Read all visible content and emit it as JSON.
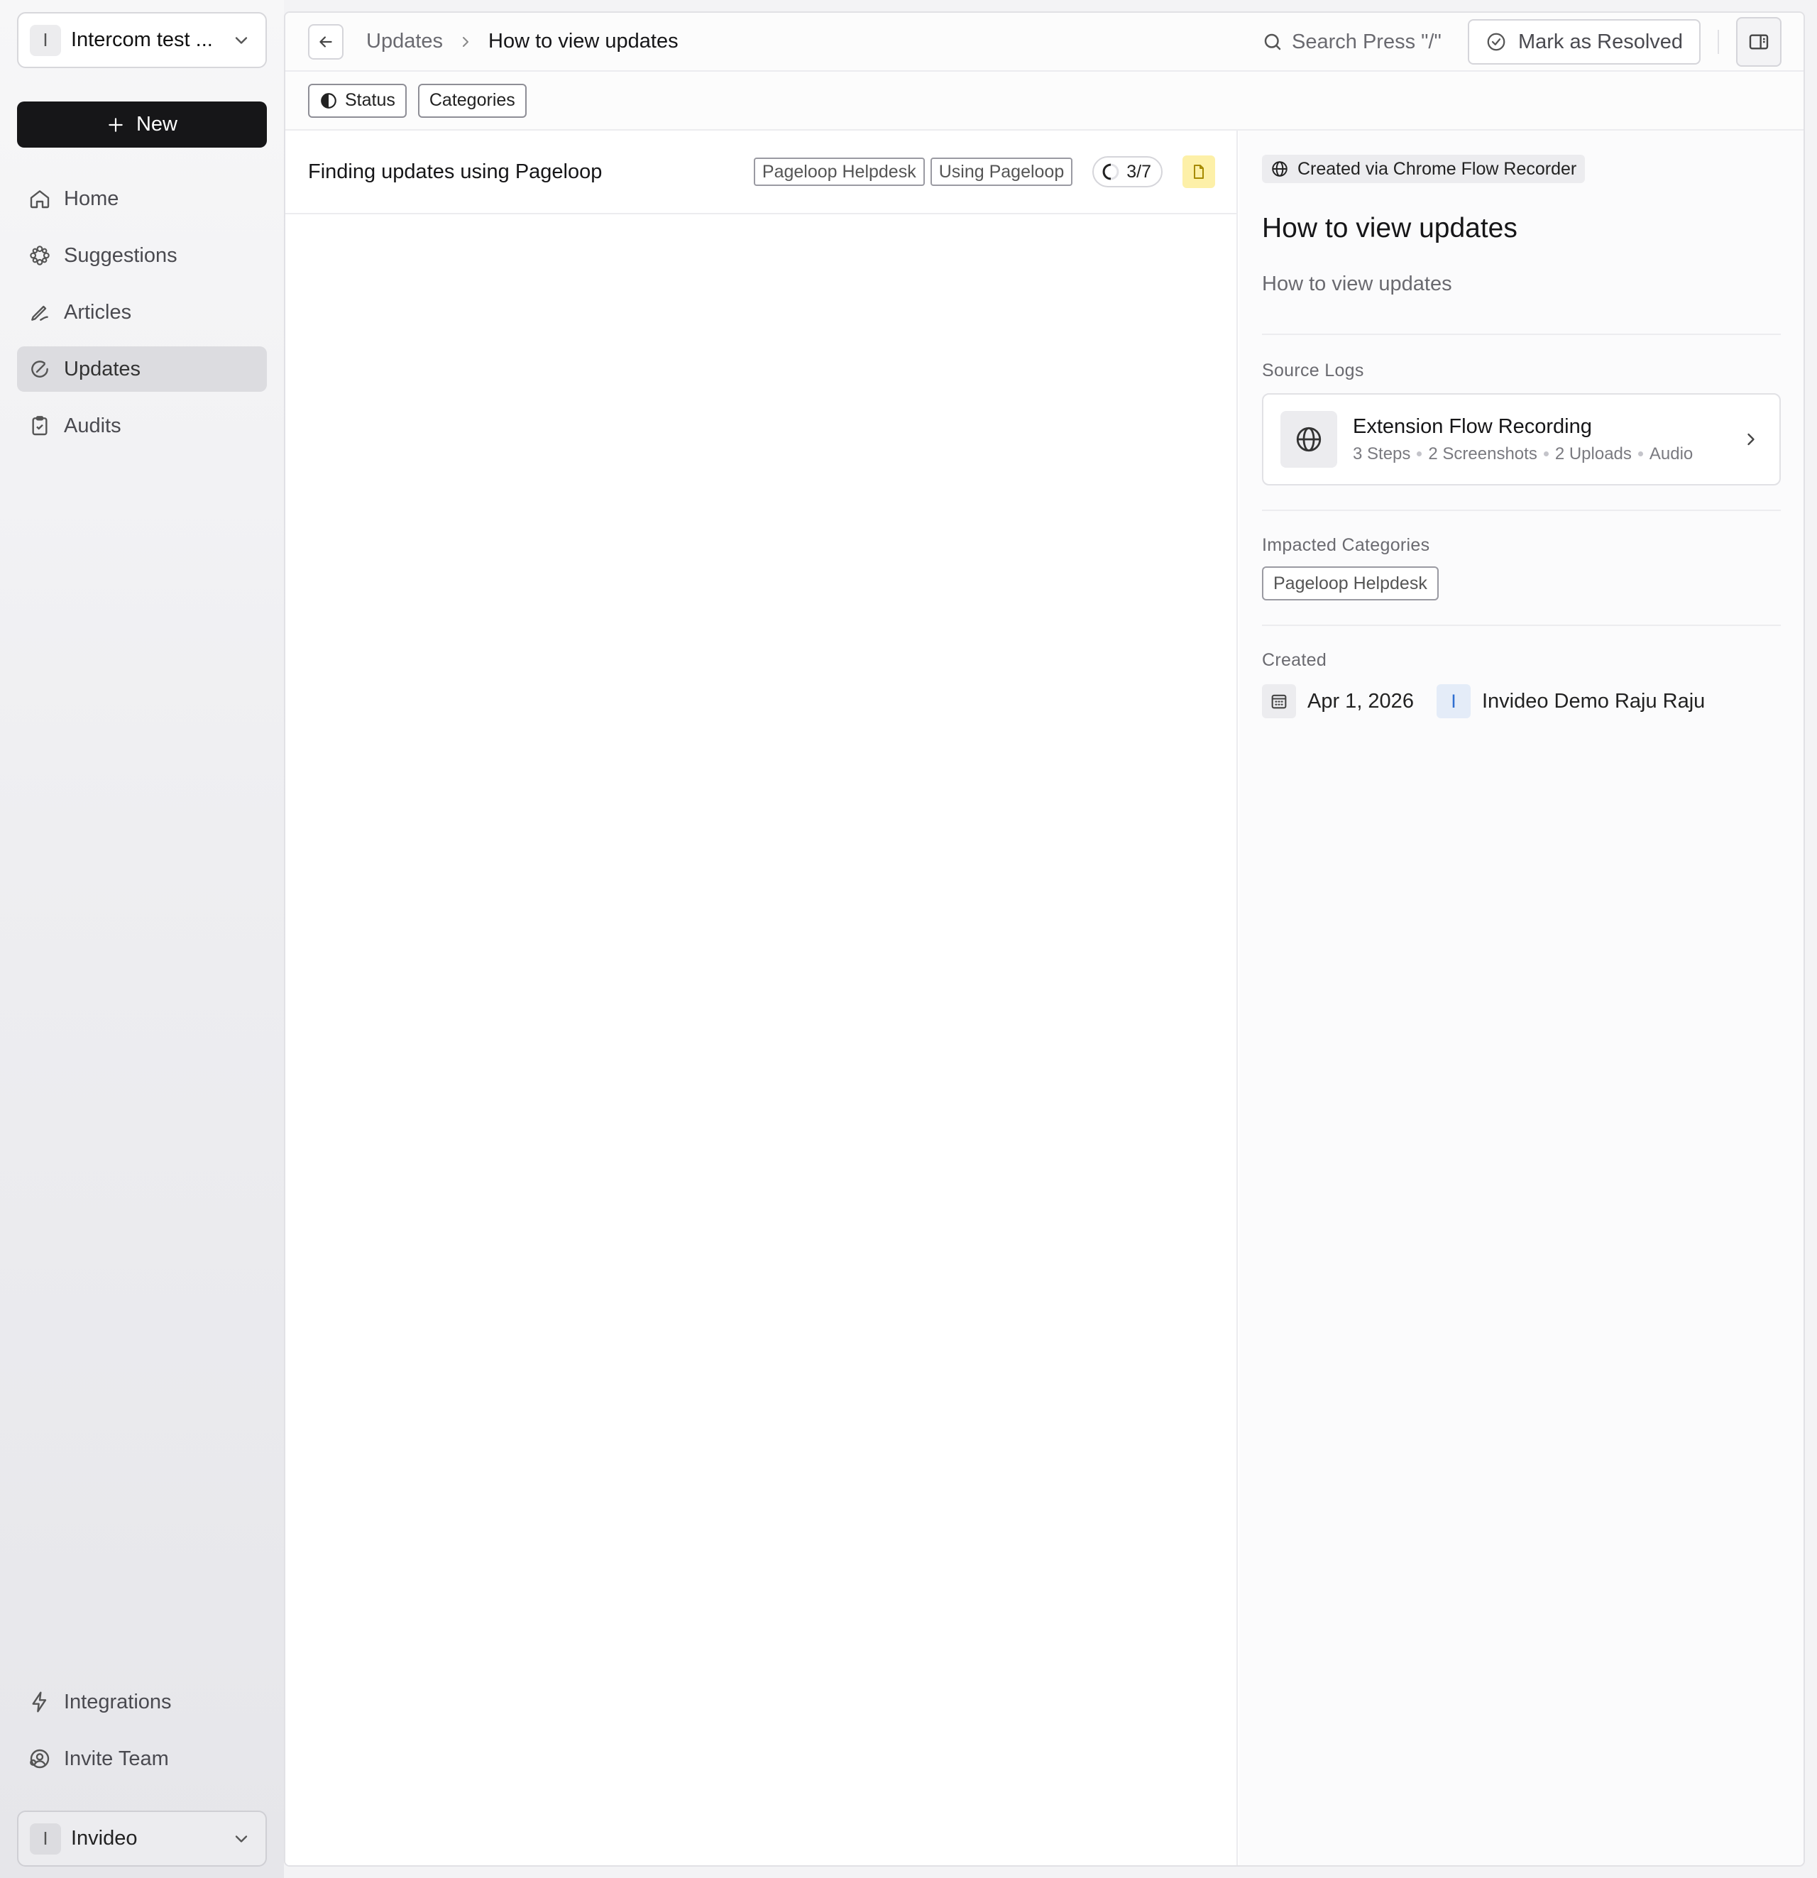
{
  "workspace": {
    "avatar_letter": "I",
    "name": "Intercom test ..."
  },
  "new_button": {
    "label": "New"
  },
  "nav": {
    "items": [
      {
        "label": "Home",
        "icon": "home-icon"
      },
      {
        "label": "Suggestions",
        "icon": "sparkle-icon"
      },
      {
        "label": "Articles",
        "icon": "pen-icon"
      },
      {
        "label": "Updates",
        "icon": "updates-icon",
        "active": true
      },
      {
        "label": "Audits",
        "icon": "clipboard-icon"
      }
    ],
    "bottom_items": [
      {
        "label": "Integrations",
        "icon": "bolt-icon"
      },
      {
        "label": "Invite Team",
        "icon": "team-icon"
      }
    ]
  },
  "user": {
    "avatar_letter": "I",
    "name": "Invideo"
  },
  "topbar": {
    "breadcrumb_parent": "Updates",
    "breadcrumb_current": "How to view updates",
    "search_label": "Search Press \"/\"",
    "resolve_label": "Mark as Resolved"
  },
  "filters": {
    "status_label": "Status",
    "categories_label": "Categories"
  },
  "list": {
    "rows": [
      {
        "title": "Finding updates using Pageloop",
        "tags": [
          "Pageloop Helpdesk",
          "Using Pageloop"
        ],
        "progress": "3/7"
      }
    ]
  },
  "detail": {
    "source_badge": "Created via Chrome Flow Recorder",
    "title": "How to view updates",
    "subtitle": "How to view updates",
    "source_logs_label": "Source Logs",
    "log": {
      "title": "Extension Flow Recording",
      "meta": [
        "3 Steps",
        "2 Screenshots",
        "2 Uploads",
        "Audio"
      ]
    },
    "impacted_label": "Impacted Categories",
    "impacted_category": "Pageloop Helpdesk",
    "created_label": "Created",
    "created_date": "Apr 1, 2026",
    "creator_letter": "I",
    "creator_name": "Invideo Demo Raju Raju"
  },
  "colors": {
    "primary_button": "#161618",
    "active_nav": "#dcdce0",
    "doc_badge": "#fdf0a8",
    "user_badge": "#e4ecf8"
  }
}
